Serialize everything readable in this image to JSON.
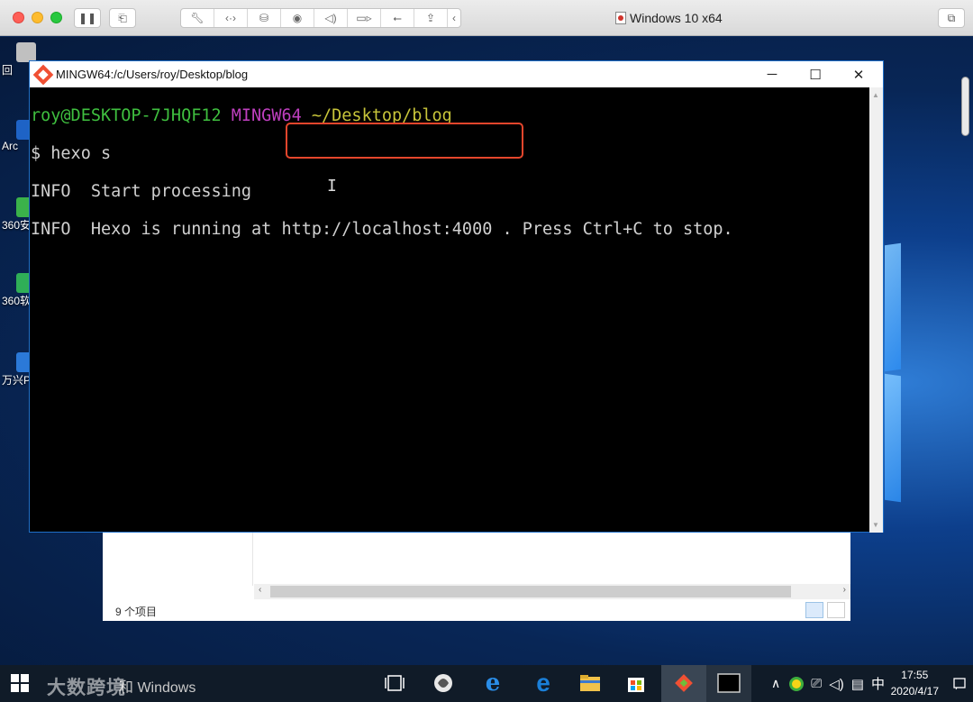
{
  "vm": {
    "title": "Windows 10 x64",
    "toolbar_icons": [
      "pause-icon",
      "snapshot-icon",
      "wrench-icon",
      "code-icon",
      "disk-icon",
      "camera-icon",
      "sound-icon",
      "video-icon",
      "usb-icon",
      "share-icon",
      "chevron-left-icon"
    ]
  },
  "desktop": {
    "icons": [
      {
        "label": "回",
        "color": "#c0c0c0"
      },
      {
        "label": "Arc",
        "color": "#1e63c6"
      },
      {
        "label": "360安",
        "color": "#3bb24a"
      },
      {
        "label": "360软",
        "color": "#2fae57"
      },
      {
        "label": "万兴P",
        "color": "#2b79d8"
      }
    ]
  },
  "terminal": {
    "title": "MINGW64:/c/Users/roy/Desktop/blog",
    "prompt_user": "roy@DESKTOP-7JHQF12",
    "prompt_env": "MINGW64",
    "prompt_path": "~/Desktop/blog",
    "command": "$ hexo s",
    "line1": "INFO  Start processing",
    "line2_prefix": "INFO  Hexo is running at ",
    "line2_url": "http://localhost:4000",
    "line2_suffix": " . Press Ctrl+C to stop.",
    "cursor": "I",
    "minimize": "─",
    "maximize": "☐",
    "close": "✕"
  },
  "explorer": {
    "status": "9 个项目"
  },
  "taskbar": {
    "search_text": "和 Windows",
    "watermark": "大数跨境",
    "input_method": "中",
    "time": "17:55",
    "date": "2020/4/17",
    "tray_caret": "∧"
  }
}
